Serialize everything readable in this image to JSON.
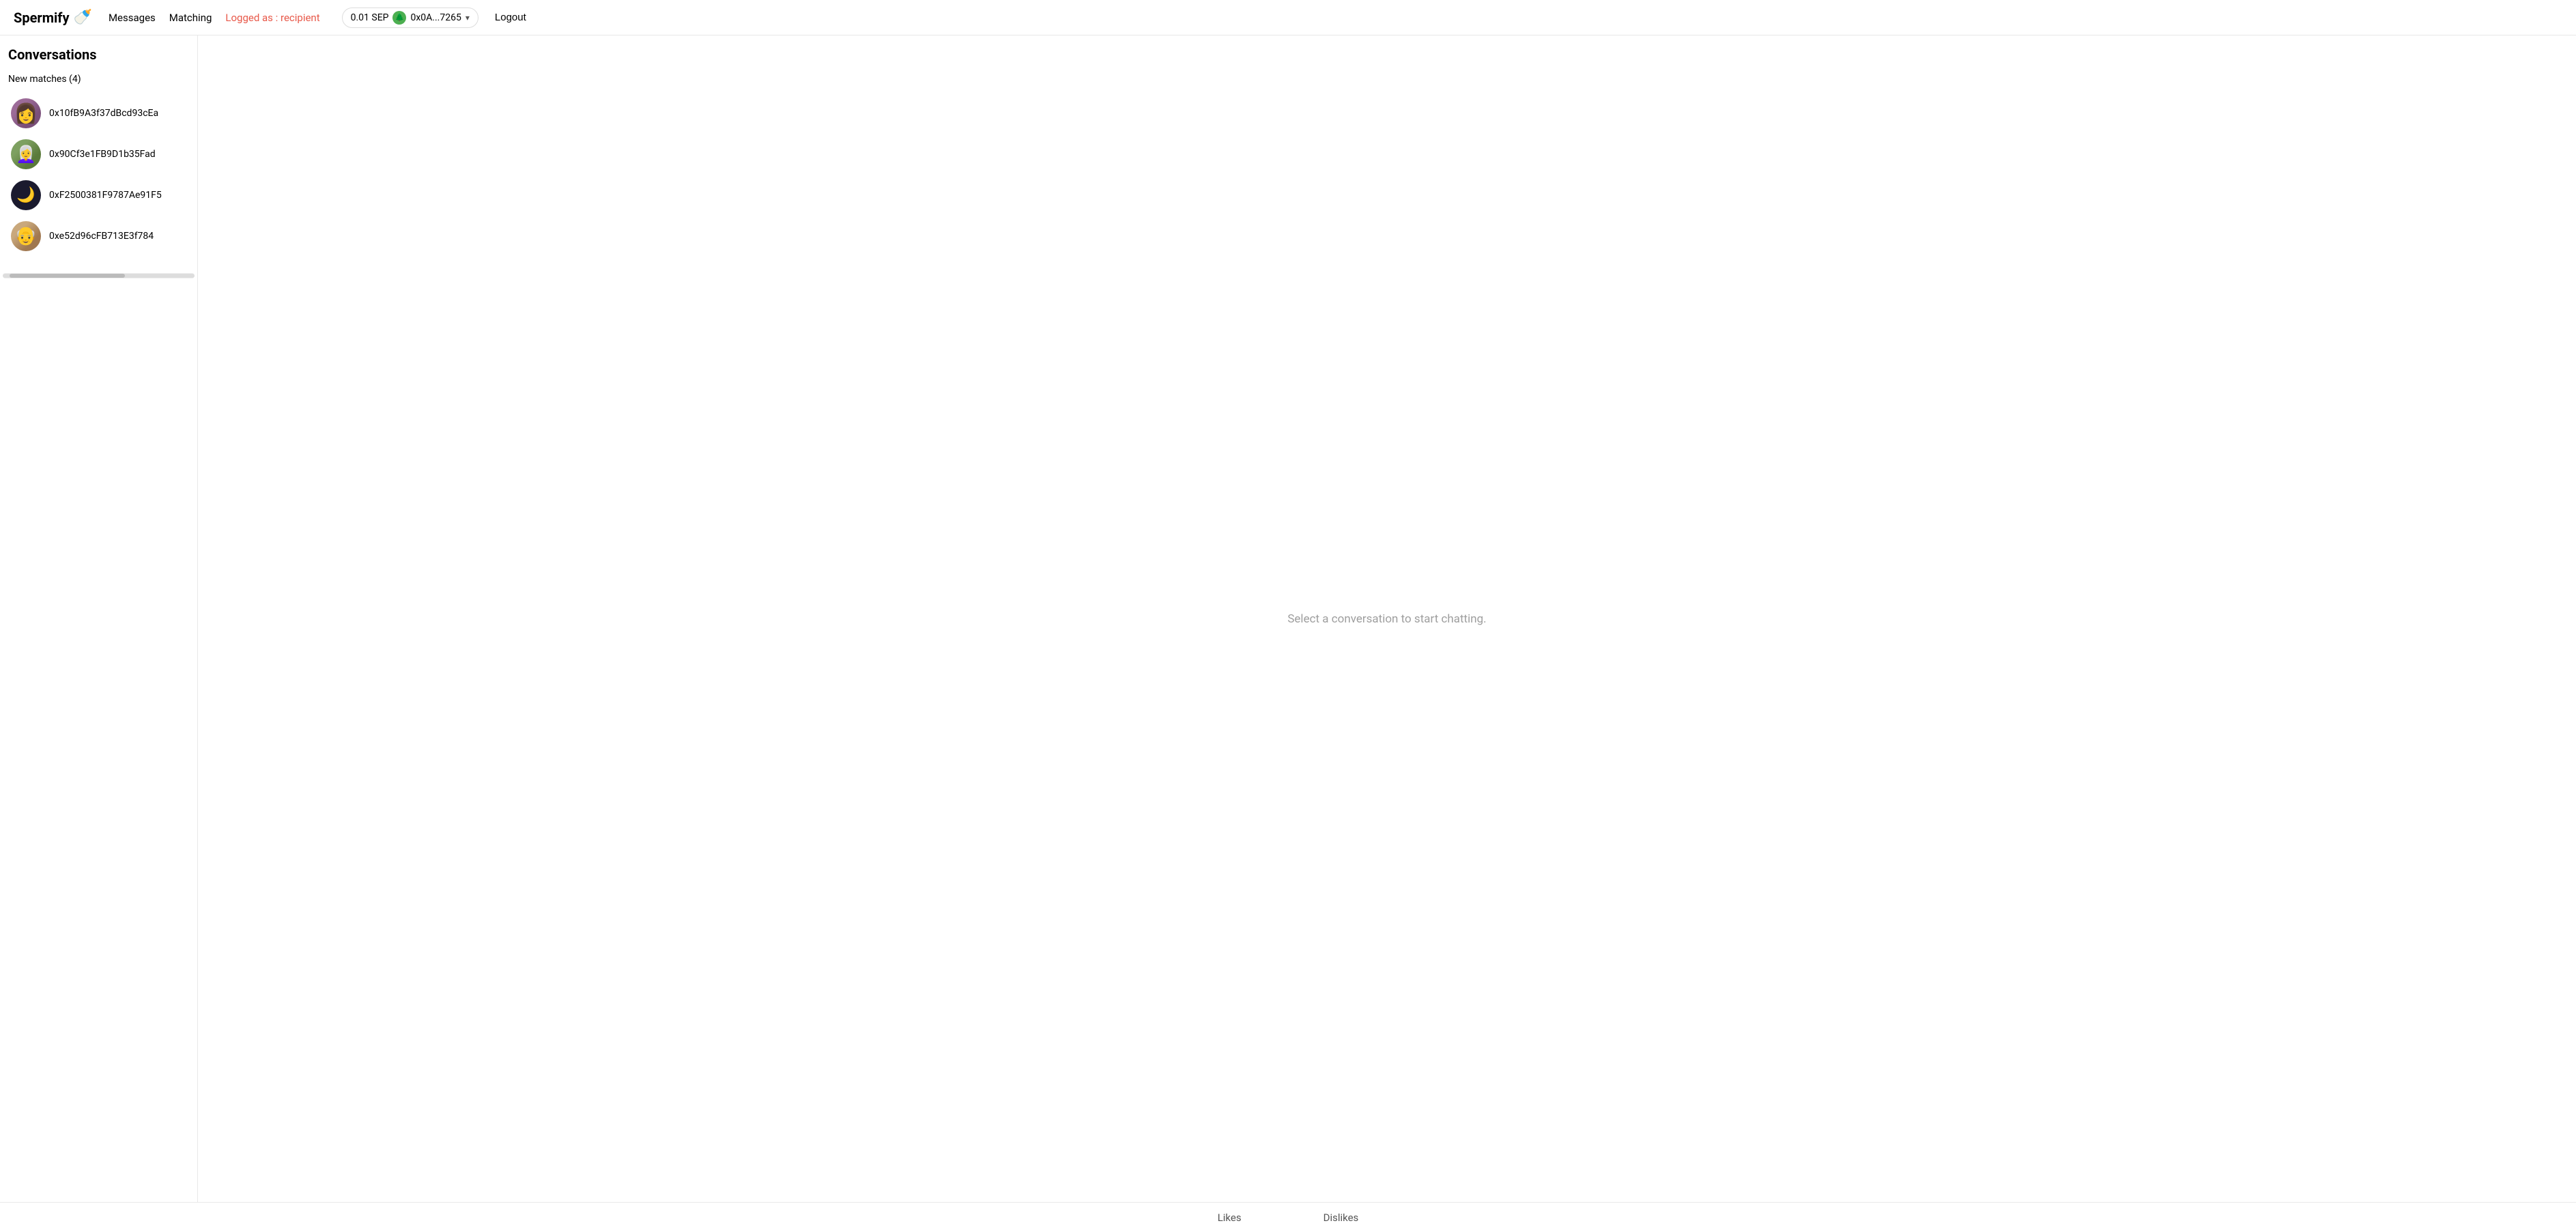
{
  "header": {
    "logo_text": "Spermify",
    "logo_emoji": "🍼",
    "nav": {
      "messages_label": "Messages",
      "matching_label": "Matching",
      "logged_as_label": "Logged as : recipient"
    },
    "wallet": {
      "balance": "0.01 SEP",
      "address": "0x0A...7265",
      "icon_emoji": "🌲"
    },
    "logout_label": "Logout"
  },
  "sidebar": {
    "title": "Conversations",
    "new_matches_label": "New matches (4)",
    "matches": [
      {
        "id": 1,
        "address": "0x10fB9A3f37dBcd93cEa",
        "avatar_type": "person1"
      },
      {
        "id": 2,
        "address": "0x90Cf3e1FB9D1b35Fad",
        "avatar_type": "person2"
      },
      {
        "id": 3,
        "address": "0xF2500381F9787Ae91F5",
        "avatar_type": "moon"
      },
      {
        "id": 4,
        "address": "0xe52d96cFB713E3f784",
        "avatar_type": "person4"
      }
    ]
  },
  "chat": {
    "empty_message": "Select a conversation to start chatting."
  },
  "bottom_bar": {
    "likes_label": "Likes",
    "dislikes_label": "Dislikes"
  }
}
